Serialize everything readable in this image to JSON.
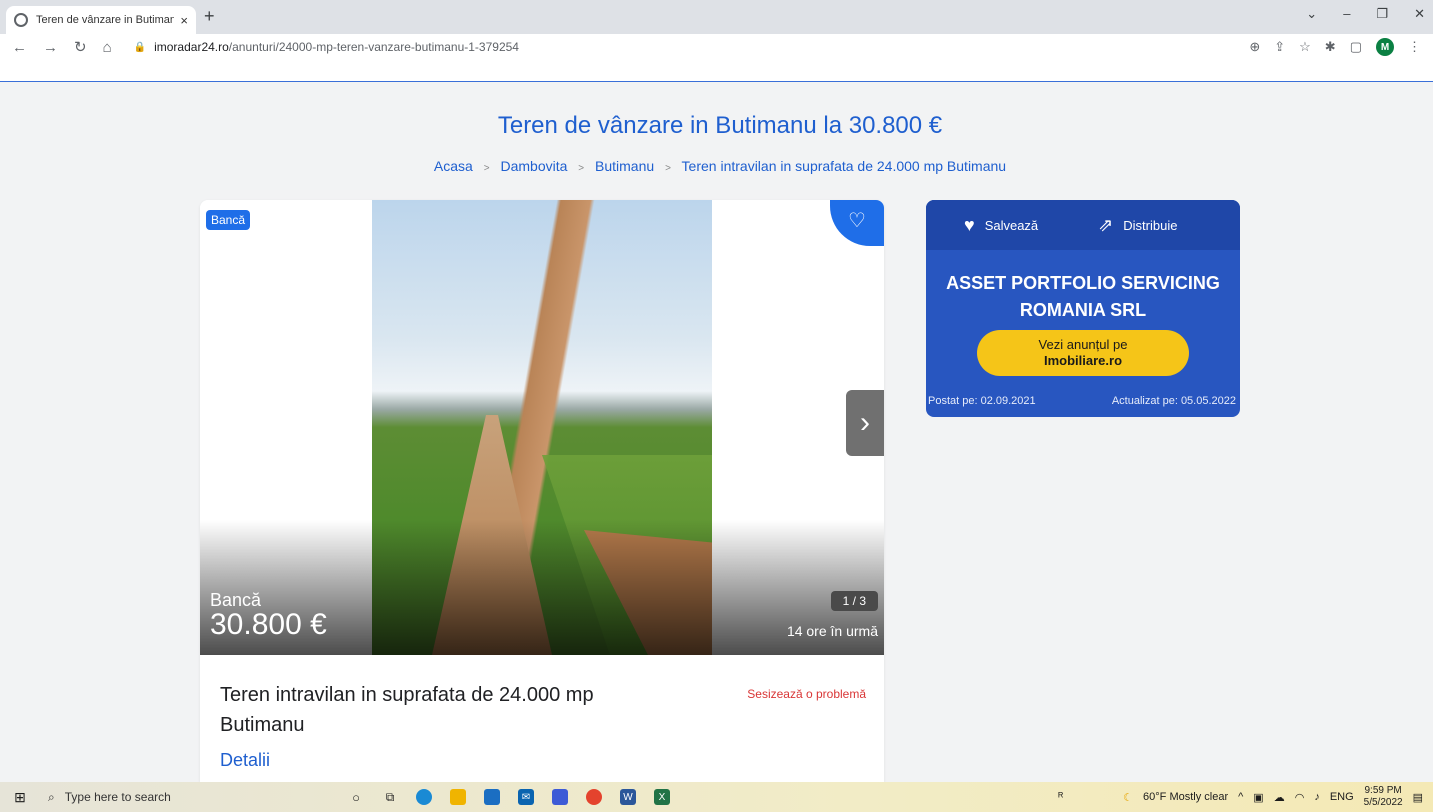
{
  "browser": {
    "tab_title": "Teren de vânzare in Butimanu la",
    "tab_close": "×",
    "new_tab": "+",
    "url_domain": "imoradar24.ro",
    "url_path": "/anunturi/24000-mp-teren-vanzare-butimanu-1-379254",
    "avatar_letter": "M"
  },
  "page": {
    "title": "Teren de vânzare in Butimanu la 30.800 €",
    "breadcrumb": [
      "Acasa",
      "Dambovita",
      "Butimanu",
      "Teren intravilan in suprafata de 24.000 mp Butimanu"
    ],
    "breadcrumb_sep": ">"
  },
  "listing": {
    "badge": "Bancă",
    "seller_type": "Bancă",
    "price": "30.800 €",
    "counter": "1 / 3",
    "posted_ago": "14 ore în urmă",
    "title": "Teren intravilan in suprafata de 24.000 mp Butimanu",
    "report_label": "Sesizează o problemă",
    "details_label": "Detalii"
  },
  "sidebar": {
    "save_label": "Salvează",
    "share_label": "Distribuie",
    "company": "ASSET PORTFOLIO SERVICING ROMANIA SRL",
    "cta_line1": "Vezi anunțul pe",
    "cta_line2": "Imobiliare.ro",
    "posted": "Postat pe: 02.09.2021",
    "updated": "Actualizat pe: 05.05.2022"
  },
  "taskbar": {
    "search_placeholder": "Type here to search",
    "weather": "60°F  Mostly clear",
    "lang": "ENG",
    "time": "9:59 PM",
    "date": "5/5/2022"
  },
  "colors": {
    "link_blue": "#1f5fcf",
    "sidebar_blue": "#2856c0",
    "cta_yellow": "#f5c518",
    "report_red": "#d93636"
  }
}
